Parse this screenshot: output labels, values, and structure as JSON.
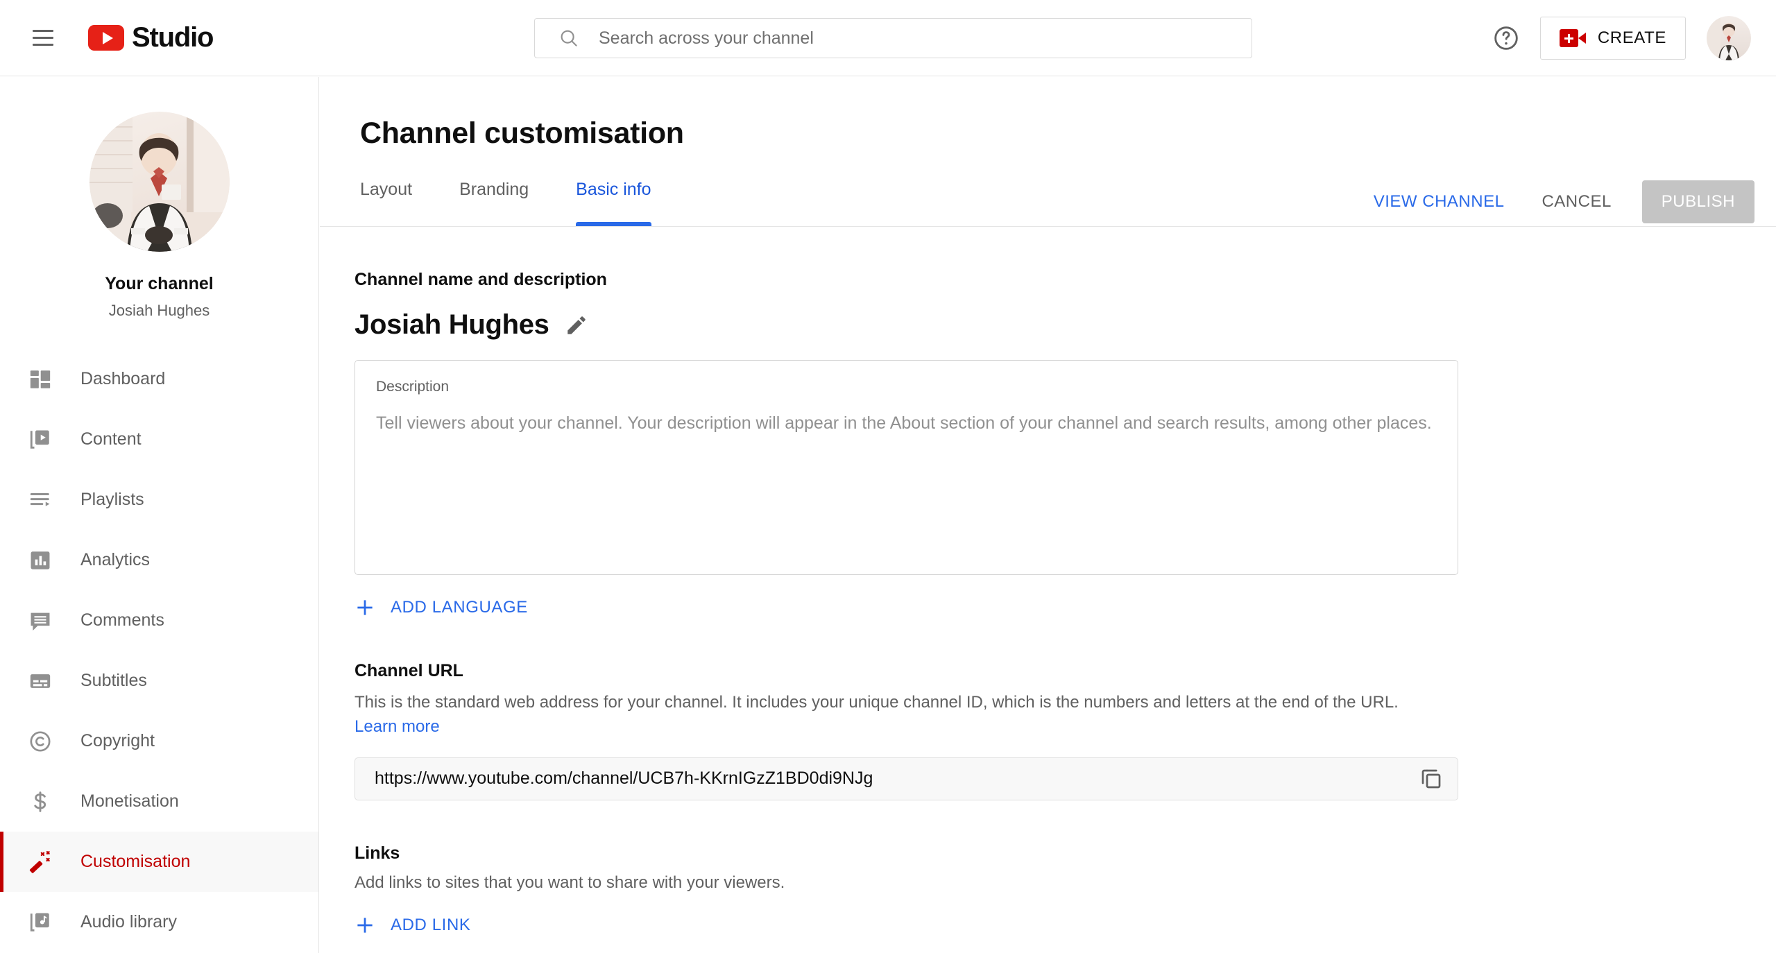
{
  "topbar": {
    "menu_icon": "hamburger-menu-icon",
    "brand_text": "Studio",
    "brand_logo_icon": "youtube-play-logo-icon",
    "search_placeholder": "Search across your channel",
    "search_value": "",
    "search_icon": "search-icon",
    "help_icon": "help-circle-icon",
    "create_label": "CREATE",
    "create_icon": "video-camera-plus-icon",
    "avatar_icon": "account-avatar"
  },
  "sidebar": {
    "your_channel_label": "Your channel",
    "channel_name": "Josiah Hughes",
    "avatar_icon": "channel-avatar",
    "items": [
      {
        "label": "Dashboard",
        "icon": "dashboard-icon",
        "active": false
      },
      {
        "label": "Content",
        "icon": "content-video-icon",
        "active": false
      },
      {
        "label": "Playlists",
        "icon": "playlist-icon",
        "active": false
      },
      {
        "label": "Analytics",
        "icon": "analytics-bar-icon",
        "active": false
      },
      {
        "label": "Comments",
        "icon": "comment-icon",
        "active": false
      },
      {
        "label": "Subtitles",
        "icon": "subtitles-icon",
        "active": false
      },
      {
        "label": "Copyright",
        "icon": "copyright-icon",
        "active": false
      },
      {
        "label": "Monetisation",
        "icon": "dollar-icon",
        "active": false
      },
      {
        "label": "Customisation",
        "icon": "magic-wand-icon",
        "active": true
      },
      {
        "label": "Audio library",
        "icon": "audio-library-icon",
        "active": false
      }
    ]
  },
  "main": {
    "page_title": "Channel customisation",
    "tabs": [
      {
        "label": "Layout",
        "active": false
      },
      {
        "label": "Branding",
        "active": false
      },
      {
        "label": "Basic info",
        "active": true
      }
    ],
    "actions": {
      "view_channel": "VIEW CHANNEL",
      "cancel": "CANCEL",
      "publish": "PUBLISH",
      "publish_disabled": true
    },
    "name_section": {
      "heading": "Channel name and description",
      "channel_name": "Josiah Hughes",
      "edit_icon": "pencil-edit-icon"
    },
    "description": {
      "field_label": "Description",
      "value": "",
      "placeholder": "Tell viewers about your channel. Your description will appear in the About section of your channel and search results, among other places."
    },
    "add_language": {
      "label": "ADD LANGUAGE",
      "icon": "plus-icon"
    },
    "channel_url": {
      "heading": "Channel URL",
      "description_before_link": "This is the standard web address for your channel. It includes your unique channel ID, which is the numbers and letters at the end of the URL. ",
      "learn_more": "Learn more",
      "value": "https://www.youtube.com/channel/UCB7h-KKrnIGzZ1BD0di9NJg",
      "copy_icon": "copy-icon"
    },
    "links": {
      "heading": "Links",
      "description": "Add links to sites that you want to share with your viewers.",
      "add_link_label": "ADD LINK",
      "add_link_icon": "plus-icon"
    }
  },
  "colors": {
    "accent_blue": "#2a6ae8",
    "brand_red": "#e62117",
    "active_red": "#c00000",
    "text_primary": "#0f0f0f",
    "text_secondary": "#606060"
  }
}
